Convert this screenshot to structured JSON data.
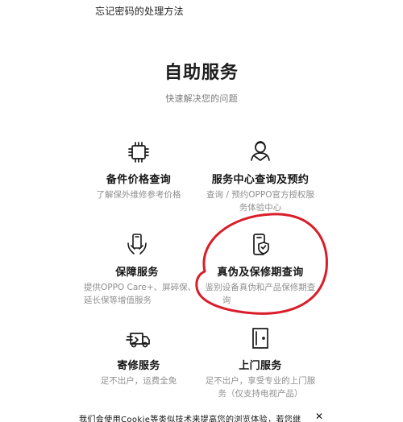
{
  "header": {
    "title": "忘记密码的处理方法"
  },
  "hero": {
    "title": "自助服务",
    "subtitle": "快速解决您的问题"
  },
  "services": [
    {
      "icon": "chip-icon",
      "title": "备件价格查询",
      "desc_lines": [
        "了解保外维修参考价格"
      ]
    },
    {
      "icon": "service-agent-icon",
      "title": "服务中心查询及预约",
      "desc_lines": [
        "查询 / 预约OPPO官方授权服",
        "务体验中心"
      ]
    },
    {
      "icon": "phone-protection-icon",
      "title": "保障服务",
      "desc_lines": [
        "提供OPPO Care+、屏碎保、",
        "延长保等增值服务"
      ]
    },
    {
      "icon": "authenticity-shield-icon",
      "title": "真伪及保修期查询",
      "desc_lines": [
        "鉴别设备真伪和产品保修期查",
        "询"
      ]
    },
    {
      "icon": "delivery-truck-icon",
      "title": "寄修服务",
      "desc_lines": [
        "足不出户，运费全免"
      ]
    },
    {
      "icon": "door-icon",
      "title": "上门服务",
      "desc_lines": [
        "足不出户，享受专业的上门服",
        "务（仅支持电视产品）"
      ]
    }
  ],
  "cookie_notice": {
    "text": "我们会使用Cookie等类似技术来提高您的浏览体验，若您继",
    "close": "✕"
  },
  "colors": {
    "annotation_red": "#d91d2a",
    "text_primary": "#1f1f1f",
    "text_secondary": "#8f8f8f"
  }
}
